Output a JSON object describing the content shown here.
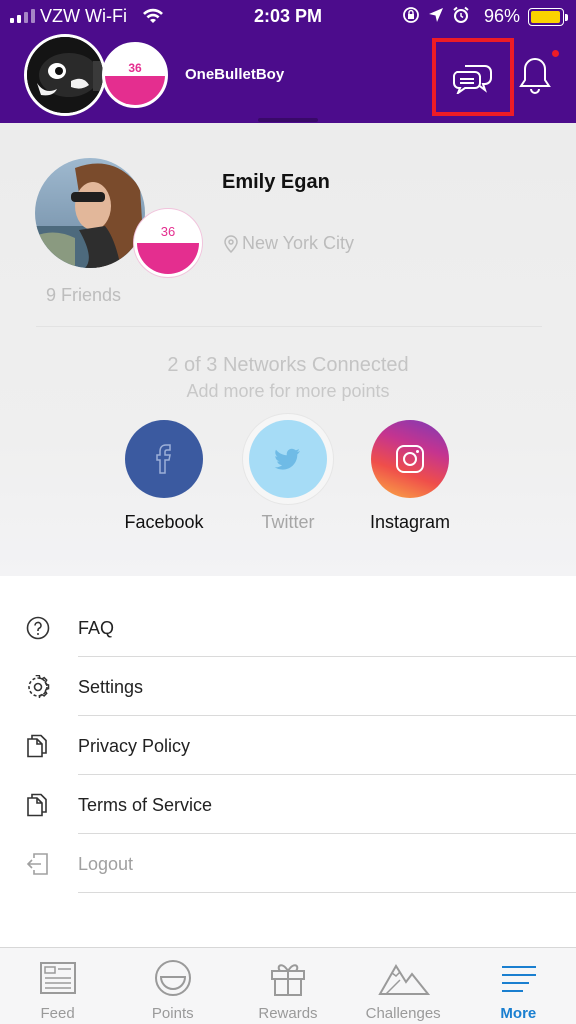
{
  "status_bar": {
    "carrier": "VZW Wi-Fi",
    "time": "2:03 PM",
    "battery_percent": "96%",
    "battery_level": 0.96
  },
  "header": {
    "username": "OneBulletBoy",
    "badge_number": "36",
    "has_notification_dot": true
  },
  "profile": {
    "name": "Emily Egan",
    "badge_number": "36",
    "location": "New York City",
    "friends": "9 Friends",
    "networks_title": "2 of 3 Networks Connected",
    "networks_subtitle": "Add more for more points",
    "networks": [
      {
        "label": "Facebook",
        "connected": true,
        "icon": "facebook-icon"
      },
      {
        "label": "Twitter",
        "connected": false,
        "icon": "twitter-icon"
      },
      {
        "label": "Instagram",
        "connected": true,
        "icon": "instagram-icon"
      }
    ]
  },
  "menu": [
    {
      "label": "FAQ",
      "icon": "question-circle-icon"
    },
    {
      "label": "Settings",
      "icon": "gear-icon"
    },
    {
      "label": "Privacy Policy",
      "icon": "document-icon"
    },
    {
      "label": "Terms of Service",
      "icon": "document-icon"
    },
    {
      "label": "Logout",
      "icon": "logout-icon"
    }
  ],
  "tabs": [
    {
      "label": "Feed",
      "icon": "feed-icon",
      "active": false
    },
    {
      "label": "Points",
      "icon": "points-icon",
      "active": false
    },
    {
      "label": "Rewards",
      "icon": "gift-icon",
      "active": false
    },
    {
      "label": "Challenges",
      "icon": "mountain-icon",
      "active": false
    },
    {
      "label": "More",
      "icon": "menu-lines-icon",
      "active": true
    }
  ],
  "colors": {
    "header_bg": "#4c0c8c",
    "accent_pink": "#e42e8f",
    "highlight_box": "#ee1c25",
    "active_tab": "#1a7fd0",
    "facebook": "#3b5aa0",
    "twitter": "#a6dcf6"
  }
}
